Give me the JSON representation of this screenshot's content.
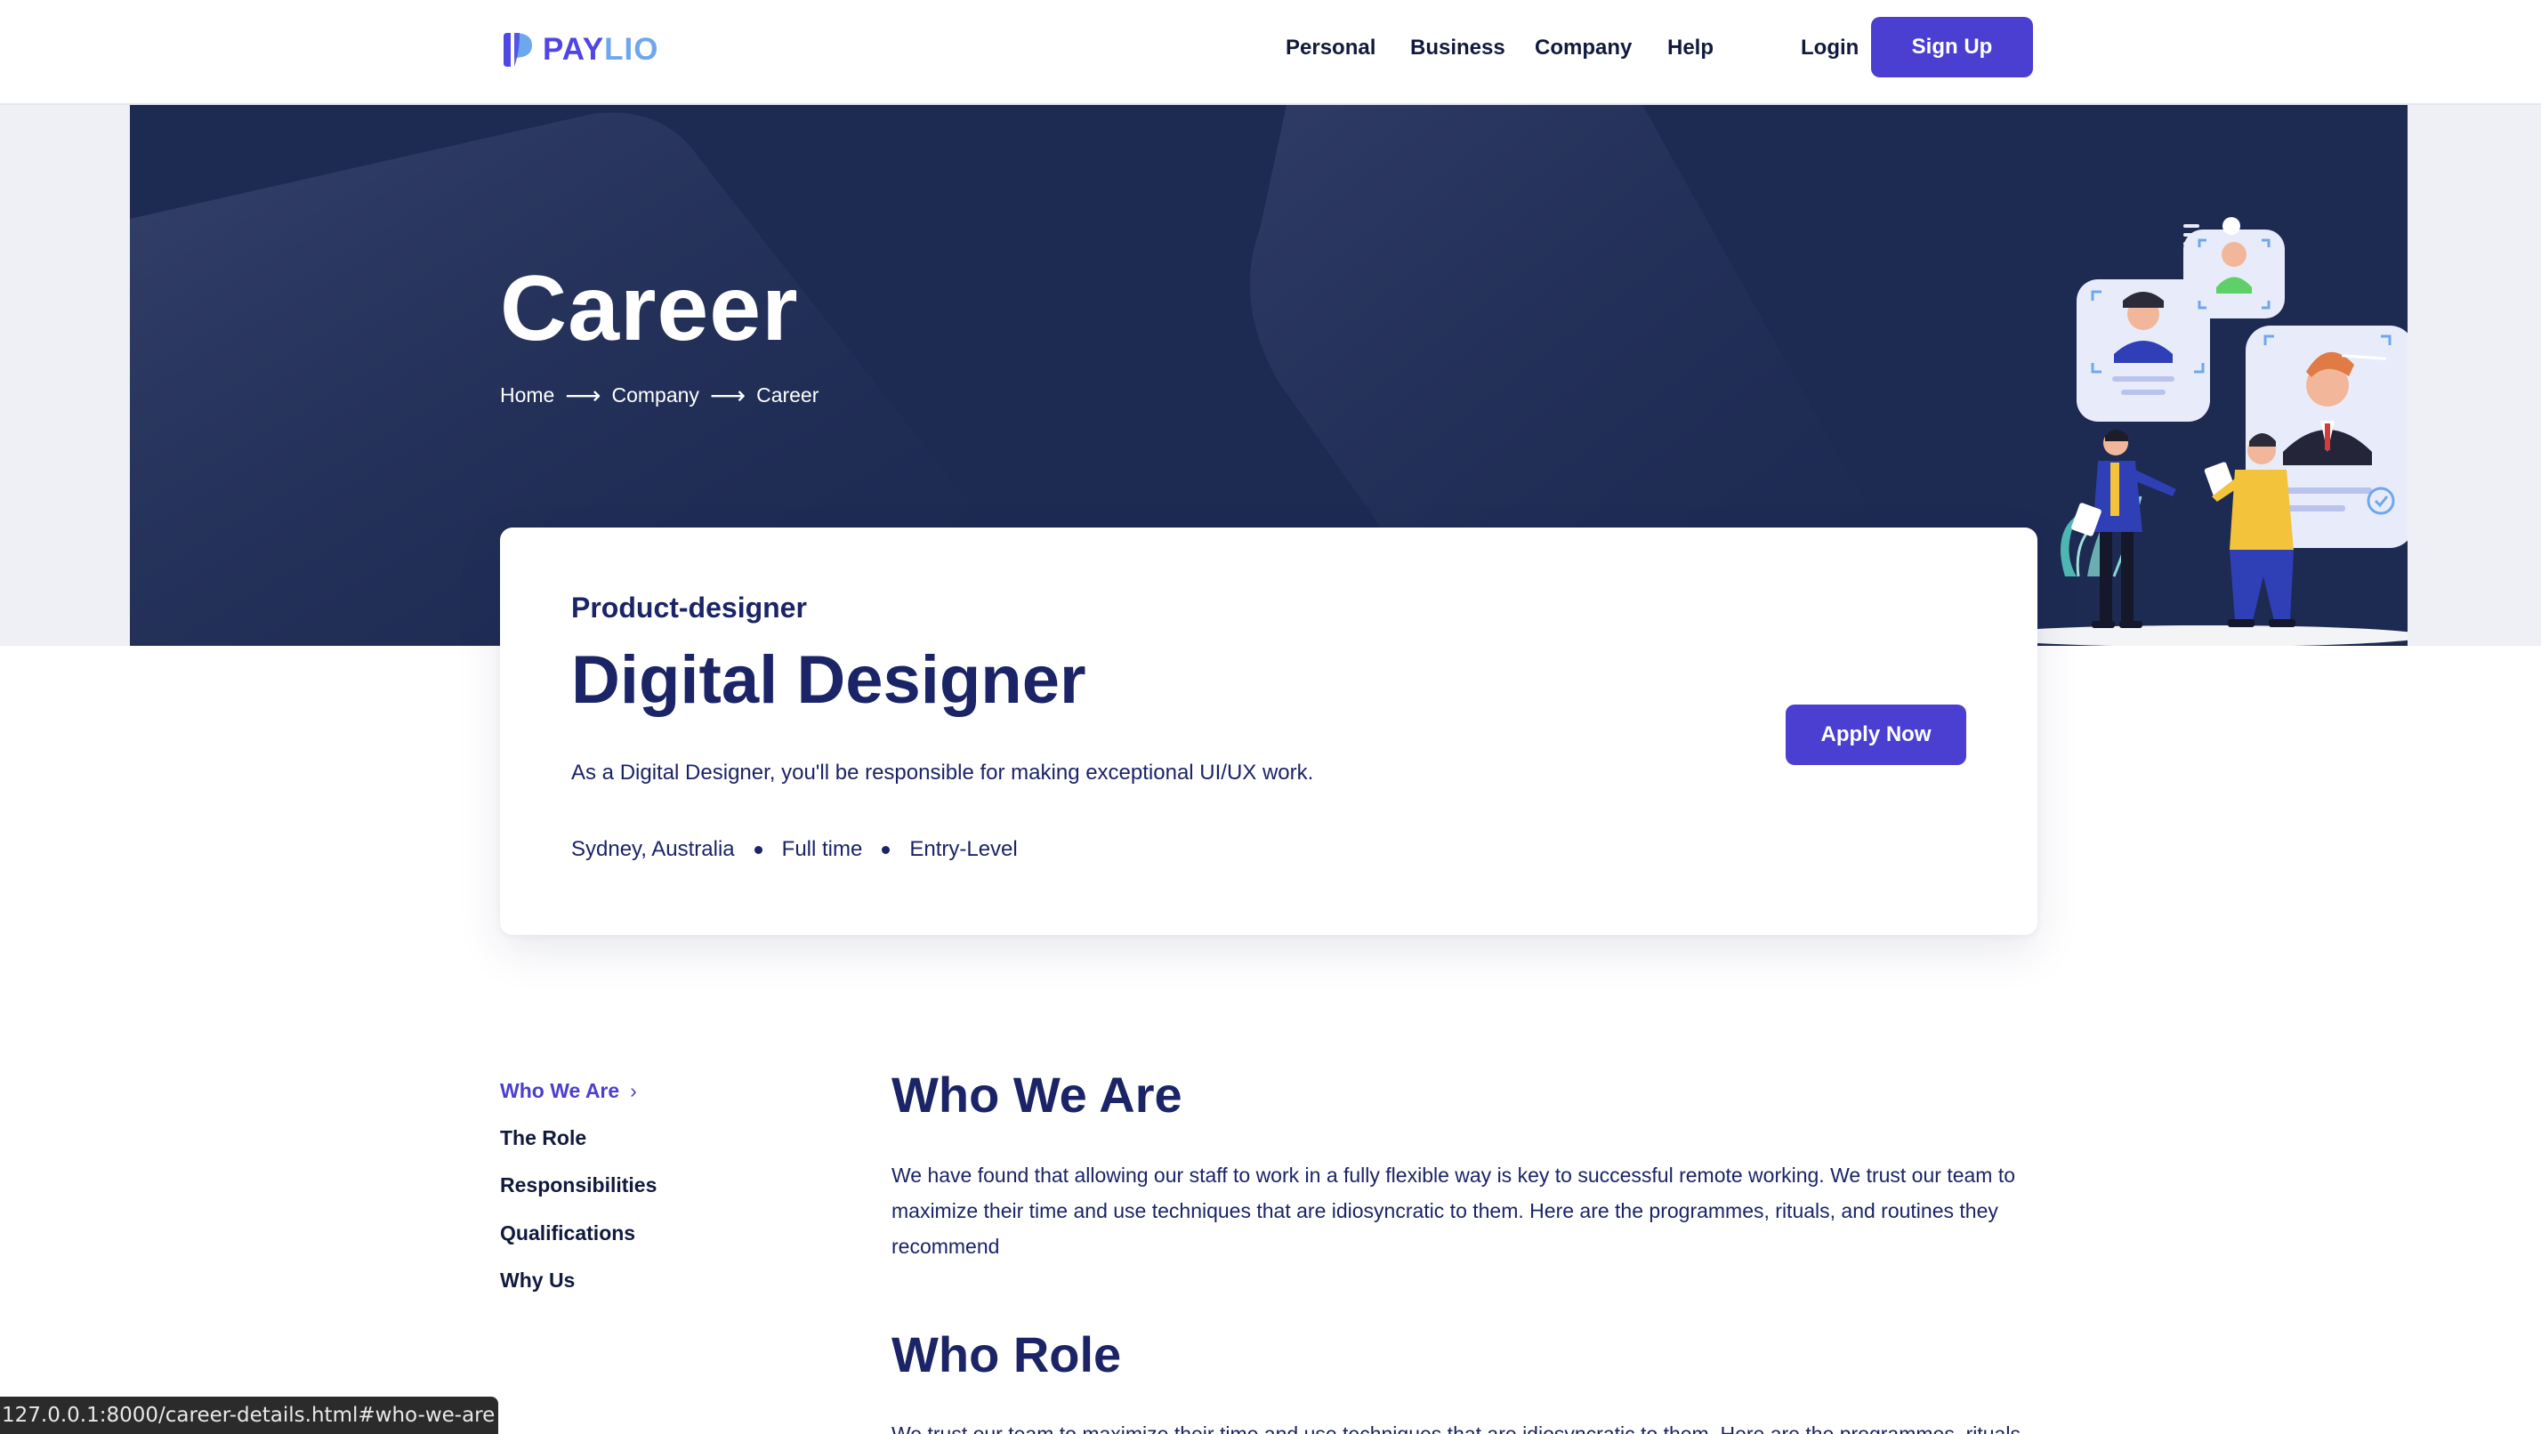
{
  "brand": {
    "name_part1": "PAY",
    "name_part2": "LIO",
    "colors": {
      "primary": "#4a3fd0",
      "logo_secondary": "#6ea7ee",
      "hero_bg": "#1d2a52",
      "text": "#1a2466"
    }
  },
  "nav": {
    "items": [
      "Personal",
      "Business",
      "Company",
      "Help"
    ],
    "login": "Login",
    "signup": "Sign Up"
  },
  "hero": {
    "title": "Career",
    "breadcrumb": [
      "Home",
      "Company",
      "Career"
    ],
    "separator": "⟶"
  },
  "job": {
    "category": "Product-designer",
    "title": "Digital Designer",
    "description": "As a Digital Designer, you'll be responsible for making exceptional UI/UX work.",
    "meta": [
      "Sydney, Australia",
      "Full time",
      "Entry-Level"
    ],
    "apply_label": "Apply Now"
  },
  "sidebar": {
    "items": [
      "Who We Are",
      "The Role",
      "Responsibilities",
      "Qualifications",
      "Why Us"
    ],
    "active_index": 0,
    "chevron": "›"
  },
  "sections": [
    {
      "title": "Who We Are",
      "text": "We have found that allowing our staff to work in a fully flexible way is key to successful remote working. We trust our team to maximize their time and use techniques that are idiosyncratic to them. Here are the programmes, rituals, and routines they recommend"
    },
    {
      "title": "Who Role",
      "text": "We trust our team to maximize their time and use techniques that are idiosyncratic to them. Here are the programmes, rituals"
    }
  ],
  "status_bar": {
    "url": "127.0.0.1:8000/career-details.html#who-we-are"
  }
}
